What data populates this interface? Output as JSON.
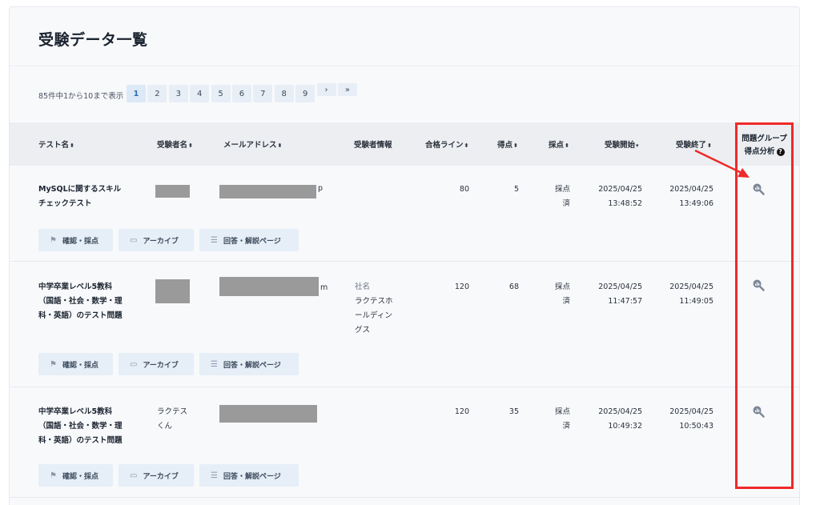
{
  "page": {
    "title": "受験データ一覧"
  },
  "pagination": {
    "summary": "85件中1から10まで表示",
    "pages": [
      "1",
      "2",
      "3",
      "4",
      "5",
      "6",
      "7",
      "8",
      "9"
    ],
    "next": "›",
    "last": "»"
  },
  "columns": {
    "test_name": "テスト名",
    "examinee_name": "受験者名",
    "email": "メールアドレス",
    "examinee_info": "受験者情報",
    "pass_line": "合格ライン",
    "score": "得点",
    "grading": "採点",
    "start": "受験開始",
    "end": "受験終了",
    "group_analysis_line1": "問題グループ",
    "group_analysis_line2": "得点分析",
    "help": "?"
  },
  "actions": {
    "confirm": "確認・採点",
    "archive": "アーカイブ",
    "answers": "回答・解説ページ"
  },
  "rows": [
    {
      "test_lines": [
        "MySQLに関するスキル",
        "チェックテスト"
      ],
      "examinee": "",
      "email_tail": "p",
      "info_label": "",
      "info_lines": [],
      "pass_line": "80",
      "score": "5",
      "grading_lines": [
        "採点",
        "済"
      ],
      "start_date": "2025/04/25",
      "start_time": "13:48:52",
      "end_date": "2025/04/25",
      "end_time": "13:49:06"
    },
    {
      "test_lines": [
        "中学卒業レベル5教科",
        "（国語・社会・数学・理",
        "科・英語）のテスト問題"
      ],
      "examinee": "",
      "email_tail": "m",
      "info_label": "社名",
      "info_lines": [
        "ラクテスホ",
        "ールディン",
        "グス"
      ],
      "pass_line": "120",
      "score": "68",
      "grading_lines": [
        "採点",
        "済"
      ],
      "start_date": "2025/04/25",
      "start_time": "11:47:57",
      "end_date": "2025/04/25",
      "end_time": "11:49:05"
    },
    {
      "test_lines": [
        "中学卒業レベル5教科",
        "（国語・社会・数学・理",
        "科・英語）のテスト問題"
      ],
      "examinee_lines": [
        "ラクテス",
        "くん"
      ],
      "email_tail": "",
      "info_label": "",
      "info_lines": [],
      "pass_line": "120",
      "score": "35",
      "grading_lines": [
        "採点",
        "済"
      ],
      "start_date": "2025/04/25",
      "start_time": "10:49:32",
      "end_date": "2025/04/25",
      "end_time": "10:50:43"
    }
  ],
  "colors": {
    "highlight": "#ef2a2a",
    "button_bg": "#e6eef7",
    "header_bg": "#eceef1"
  }
}
